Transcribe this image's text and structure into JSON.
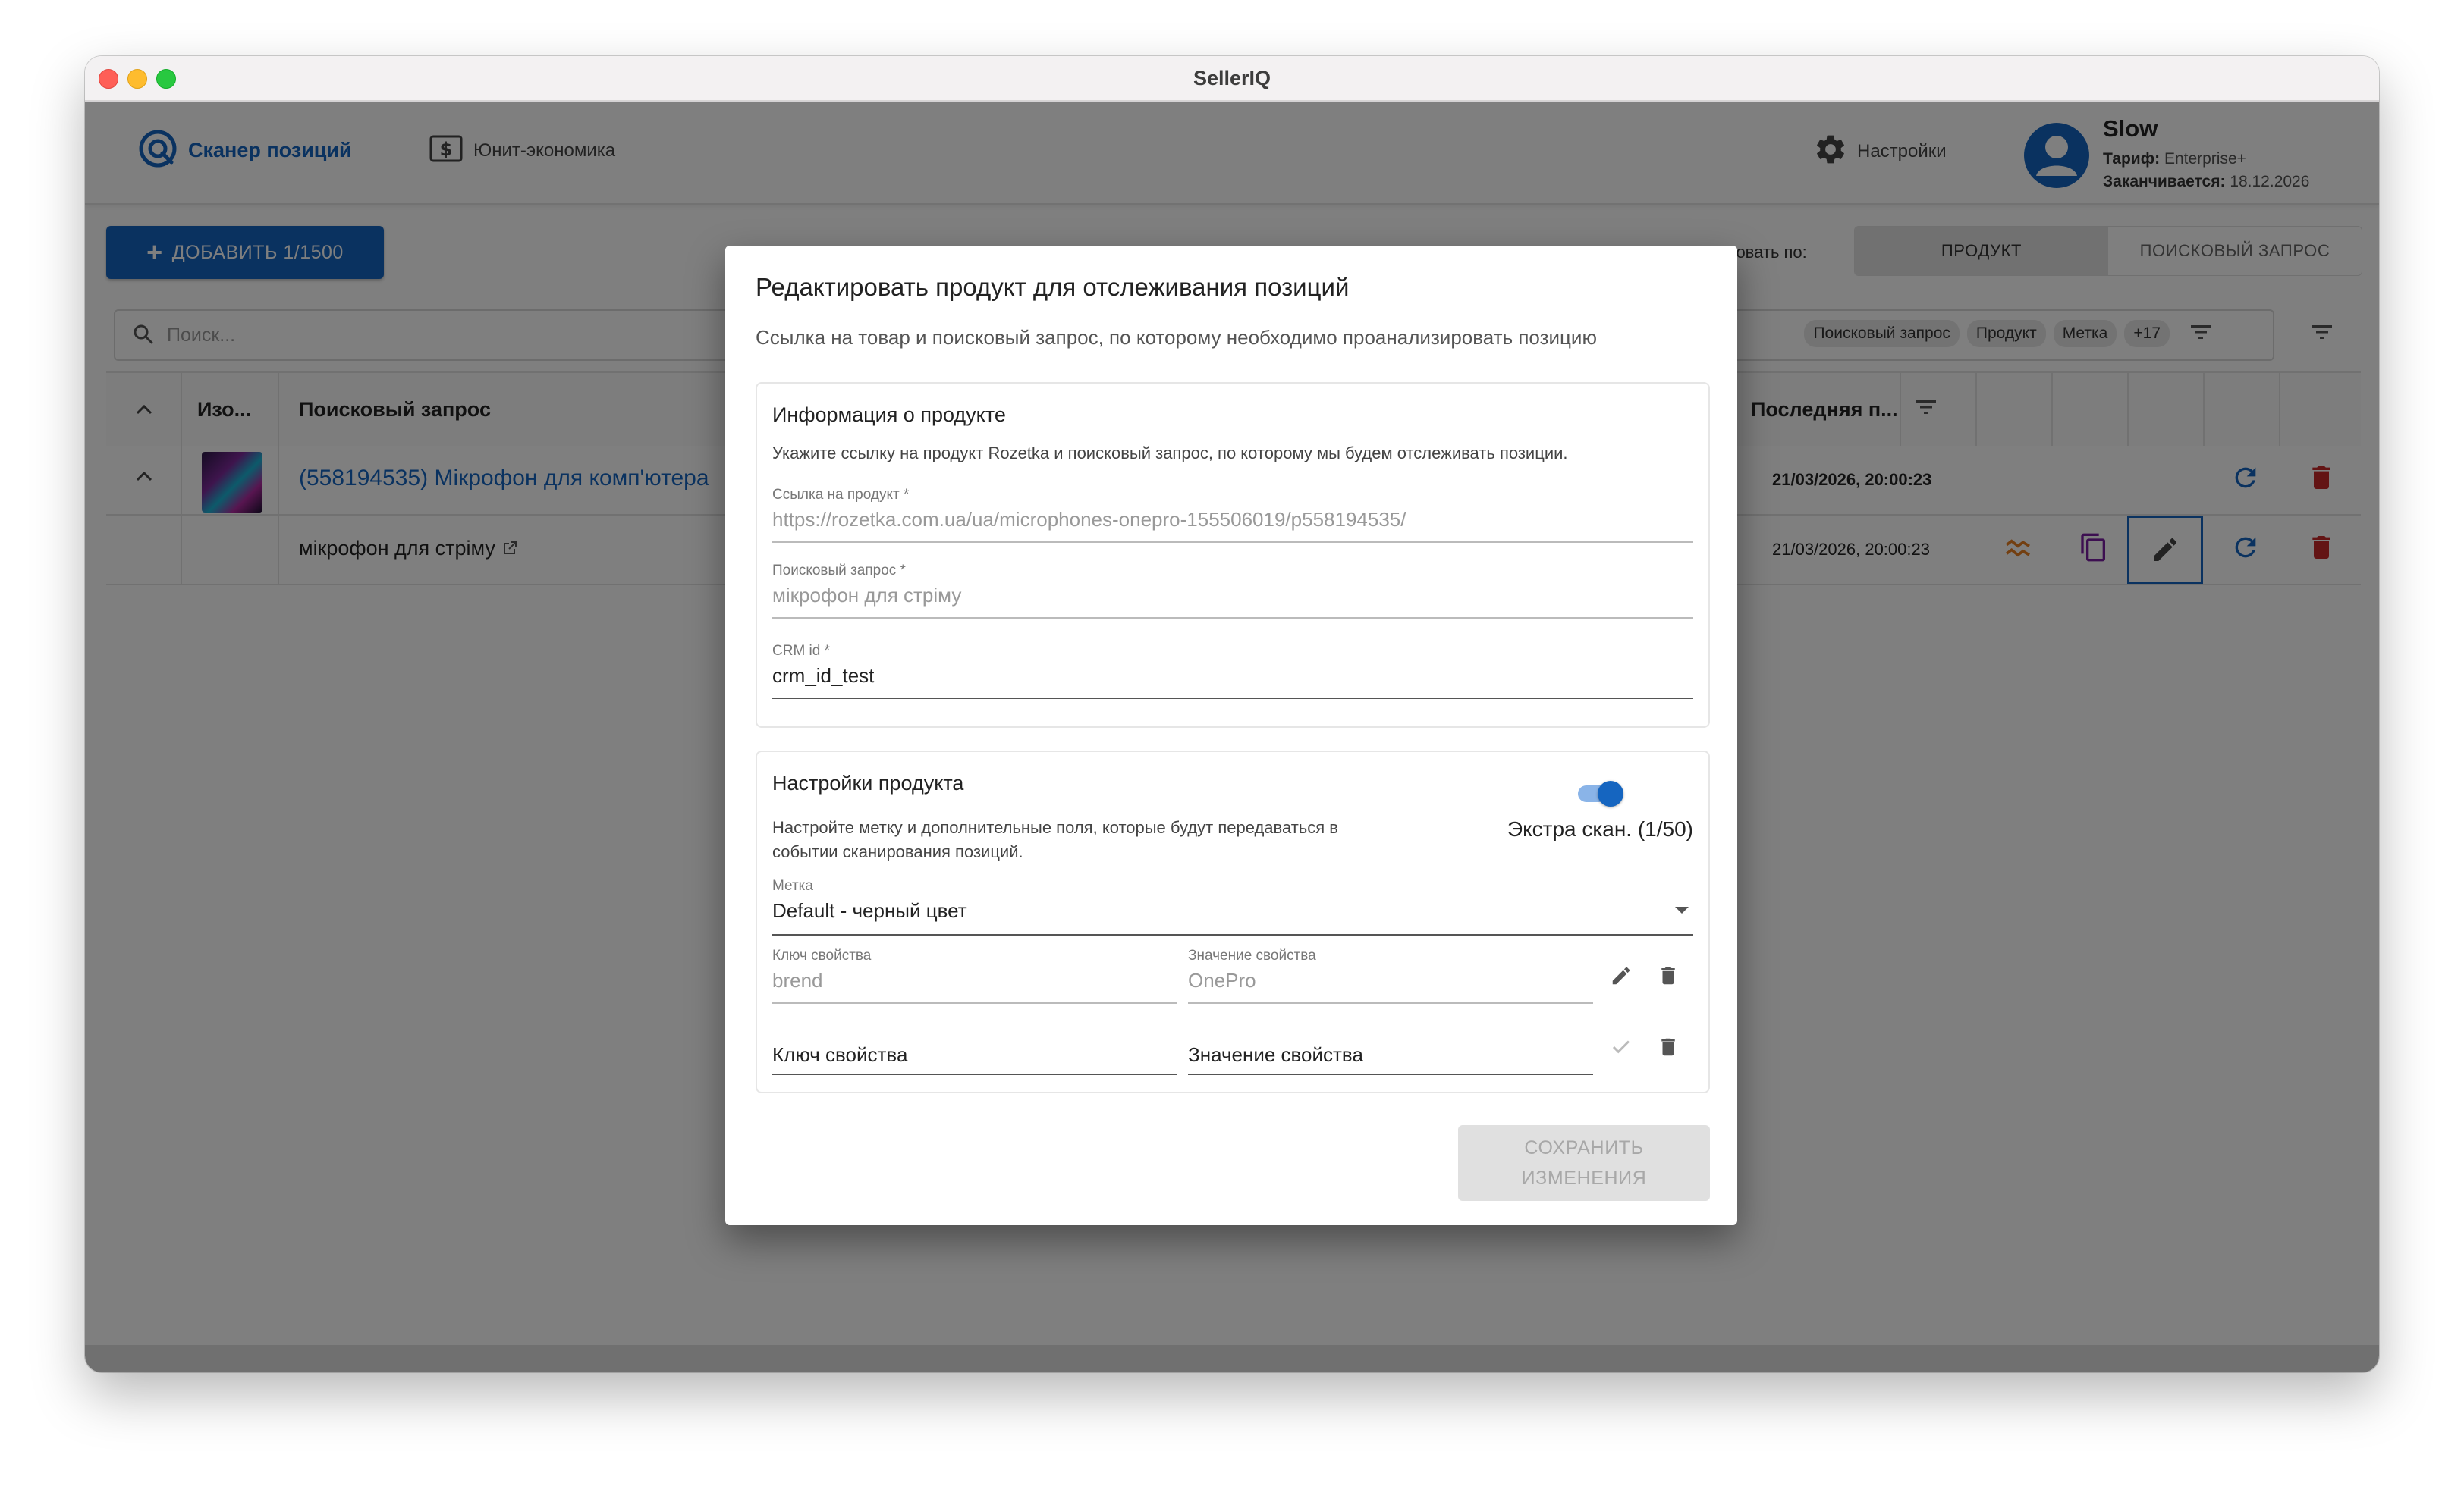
{
  "window": {
    "title": "SellerIQ"
  },
  "header": {
    "nav_scanner": "Сканер позиций",
    "nav_unit": "Юнит-экономика",
    "settings": "Настройки",
    "user": {
      "name": "Slow",
      "plan_label": "Тариф:",
      "plan_value": "Enterprise+",
      "expires_label": "Заканчивается:",
      "expires_value": "18.12.2026"
    }
  },
  "toolbar": {
    "add_button": "ДОБАВИТЬ 1/1500",
    "group_by_label": "пировать по:",
    "group_options": [
      "ПРОДУКТ",
      "ПОИСКОВЫЙ ЗАПРОС"
    ],
    "group_selected": "ПРОДУКТ"
  },
  "search": {
    "placeholder": "Поиск...",
    "chips": [
      "Поисковый запрос",
      "Продукт",
      "Метка",
      "+17"
    ]
  },
  "table": {
    "headers": {
      "image": "Изо...",
      "query": "Поисковый запрос",
      "last": "Последняя п..."
    },
    "rows": [
      {
        "title": "(558194535) Мікрофон для комп'ютера",
        "date": "21/03/2026, 20:00:23"
      },
      {
        "query": "мікрофон для стріму",
        "date": "21/03/2026, 20:00:23"
      }
    ]
  },
  "modal": {
    "title": "Редактировать продукт для отслеживания позиций",
    "subtitle": "Ссылка на товар и поисковый запрос, по которому необходимо проанализировать позицию",
    "info": {
      "heading": "Информация о продукте",
      "description": "Укажите ссылку на продукт Rozetka и поисковый запрос, по которому мы будем отслеживать позиции.",
      "link_label": "Ссылка на продукт *",
      "link_value": "https://rozetka.com.ua/ua/microphones-onepro-155506019/p558194535/",
      "query_label": "Поисковый запрос *",
      "query_value": "мікрофон для стріму",
      "crm_label": "CRM id *",
      "crm_value": "crm_id_test"
    },
    "settings": {
      "heading": "Настройки продукта",
      "description_line1": "Настройте метку и дополнительные поля, которые будут передаваться в",
      "description_line2": "событии сканирования позиций.",
      "extra_scan": "Экстра скан. (1/50)",
      "extra_scan_enabled": true,
      "tag_label": "Метка",
      "tag_value": "Default - черный цвет",
      "prop_key_label": "Ключ свойства",
      "prop_value_label": "Значение свойства",
      "prop_key": "brend",
      "prop_value": "OnePro",
      "new_key_placeholder": "Ключ свойства",
      "new_value_placeholder": "Значение свойства"
    },
    "save_line1": "СОХРАНИТЬ",
    "save_line2": "ИЗМЕНЕНИЯ"
  },
  "colors": {
    "accent": "#1565c0",
    "danger": "#c62828",
    "orange": "#e67e22",
    "purple": "#7b1fa2"
  }
}
